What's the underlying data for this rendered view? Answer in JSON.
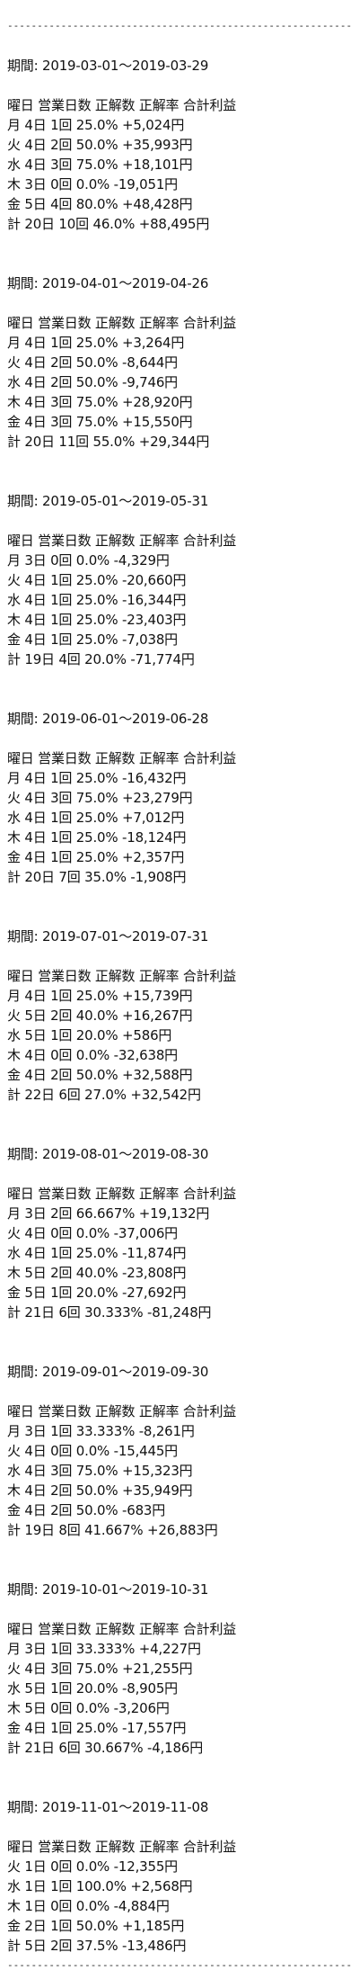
{
  "rule": "------------------------------------------------------------",
  "sections": [
    {
      "period": "期間: 2019-03-01～2019-03-29",
      "header": "曜日 営業日数 正解数 正解率 合計利益",
      "rows": [
        "月 4日 1回 25.0% +5,024円",
        "火 4日 2回 50.0% +35,993円",
        "水 4日 3回 75.0% +18,101円",
        "木 3日 0回 0.0% -19,051円",
        "金 5日 4回 80.0% +48,428円",
        "計 20日 10回 46.0% +88,495円"
      ]
    },
    {
      "period": "期間: 2019-04-01～2019-04-26",
      "header": "曜日 営業日数 正解数 正解率 合計利益",
      "rows": [
        "月 4日 1回 25.0% +3,264円",
        "火 4日 2回 50.0% -8,644円",
        "水 4日 2回 50.0% -9,746円",
        "木 4日 3回 75.0% +28,920円",
        "金 4日 3回 75.0% +15,550円",
        "計 20日 11回 55.0% +29,344円"
      ]
    },
    {
      "period": "期間: 2019-05-01～2019-05-31",
      "header": "曜日 営業日数 正解数 正解率 合計利益",
      "rows": [
        "月 3日 0回 0.0% -4,329円",
        "火 4日 1回 25.0% -20,660円",
        "水 4日 1回 25.0% -16,344円",
        "木 4日 1回 25.0% -23,403円",
        "金 4日 1回 25.0% -7,038円",
        "計 19日 4回 20.0% -71,774円"
      ]
    },
    {
      "period": "期間: 2019-06-01～2019-06-28",
      "header": "曜日 営業日数 正解数 正解率 合計利益",
      "rows": [
        "月 4日 1回 25.0% -16,432円",
        "火 4日 3回 75.0% +23,279円",
        "水 4日 1回 25.0% +7,012円",
        "木 4日 1回 25.0% -18,124円",
        "金 4日 1回 25.0% +2,357円",
        "計 20日 7回 35.0% -1,908円"
      ]
    },
    {
      "period": "期間: 2019-07-01～2019-07-31",
      "header": "曜日 営業日数 正解数 正解率 合計利益",
      "rows": [
        "月 4日 1回 25.0% +15,739円",
        "火 5日 2回 40.0% +16,267円",
        "水 5日 1回 20.0% +586円",
        "木 4日 0回 0.0% -32,638円",
        "金 4日 2回 50.0% +32,588円",
        "計 22日 6回 27.0% +32,542円"
      ]
    },
    {
      "period": "期間: 2019-08-01～2019-08-30",
      "header": "曜日 営業日数 正解数 正解率 合計利益",
      "rows": [
        "月 3日 2回 66.667% +19,132円",
        "火 4日 0回 0.0% -37,006円",
        "水 4日 1回 25.0% -11,874円",
        "木 5日 2回 40.0% -23,808円",
        "金 5日 1回 20.0% -27,692円",
        "計 21日 6回 30.333% -81,248円"
      ]
    },
    {
      "period": "期間: 2019-09-01～2019-09-30",
      "header": "曜日 営業日数 正解数 正解率 合計利益",
      "rows": [
        "月 3日 1回 33.333% -8,261円",
        "火 4日 0回 0.0% -15,445円",
        "水 4日 3回 75.0% +15,323円",
        "木 4日 2回 50.0% +35,949円",
        "金 4日 2回 50.0% -683円",
        "計 19日 8回 41.667% +26,883円"
      ]
    },
    {
      "period": "期間: 2019-10-01～2019-10-31",
      "header": "曜日 営業日数 正解数 正解率 合計利益",
      "rows": [
        "月 3日 1回 33.333% +4,227円",
        "火 4日 3回 75.0% +21,255円",
        "水 5日 1回 20.0% -8,905円",
        "木 5日 0回 0.0% -3,206円",
        "金 4日 1回 25.0% -17,557円",
        "計 21日 6回 30.667% -4,186円"
      ]
    },
    {
      "period": "期間: 2019-11-01～2019-11-08",
      "header": "曜日 営業日数 正解数 正解率 合計利益",
      "rows": [
        "火 1日 0回 0.0% -12,355円",
        "水 1日 1回 100.0% +2,568円",
        "木 1日 0回 0.0% -4,884円",
        "金 2日 1回 50.0% +1,185円",
        "計 5日 2回 37.5% -13,486円"
      ]
    }
  ]
}
